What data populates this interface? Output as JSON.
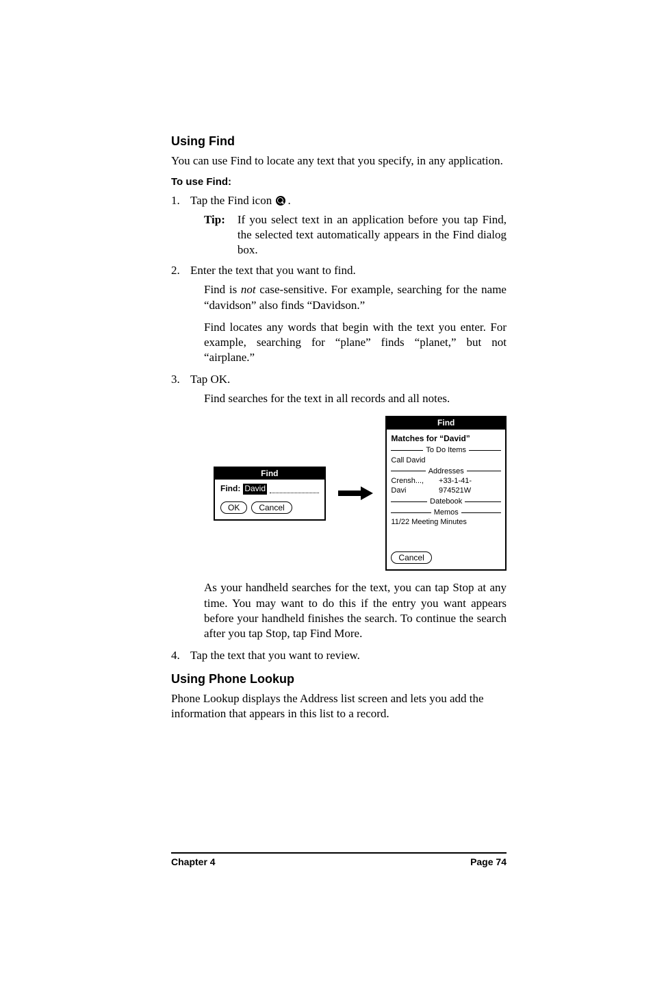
{
  "headings": {
    "using_find": "Using Find",
    "to_use_find": "To use Find:",
    "using_phone_lookup": "Using Phone Lookup"
  },
  "paras": {
    "intro": "You can use Find to locate any text that you specify, in any application.",
    "phone_intro": "Phone Lookup displays the Address list screen and lets you add the information that appears in this list to a record."
  },
  "steps": {
    "s1_pre": "Tap the Find icon ",
    "s1_post": ".",
    "tip_label": "Tip:",
    "tip_body": "If you select text in an application before you tap Find, the selected text automatically appears in the Find dialog box.",
    "s2": "Enter the text that you want to find.",
    "s2_sub1a": "Find is ",
    "s2_sub1_em": "not",
    "s2_sub1b": " case-sensitive. For example, searching for the name “davidson” also finds “Davidson.”",
    "s2_sub2": "Find locates any words that begin with the text you enter. For example, searching for “plane” finds “planet,” but not “airplane.”",
    "s3": "Tap OK.",
    "s3_sub1": "Find searches for the text in all records and all notes.",
    "s3_sub2": "As your handheld searches for the text, you can tap Stop at any time. You may want to do this if the entry you want appears before your handheld finishes the search. To continue the search after you tap Stop, tap Find More.",
    "s4": "Tap the text that you want to review."
  },
  "dialogs": {
    "find_title": "Find",
    "find_field_label": "Find:",
    "find_value": "David",
    "ok": "OK",
    "cancel": "Cancel",
    "results_title": "Find",
    "matches_for": "Matches for “David”",
    "sections": {
      "todo": "To Do Items",
      "addresses": "Addresses",
      "datebook": "Datebook",
      "memos": "Memos"
    },
    "todo_item": "Call David",
    "address_name": "Crensh..., Davi",
    "address_phone": "+33-1-41-974521W",
    "memo_item": "11/22 Meeting Minutes"
  },
  "footer": {
    "chapter": "Chapter 4",
    "page": "Page 74"
  }
}
